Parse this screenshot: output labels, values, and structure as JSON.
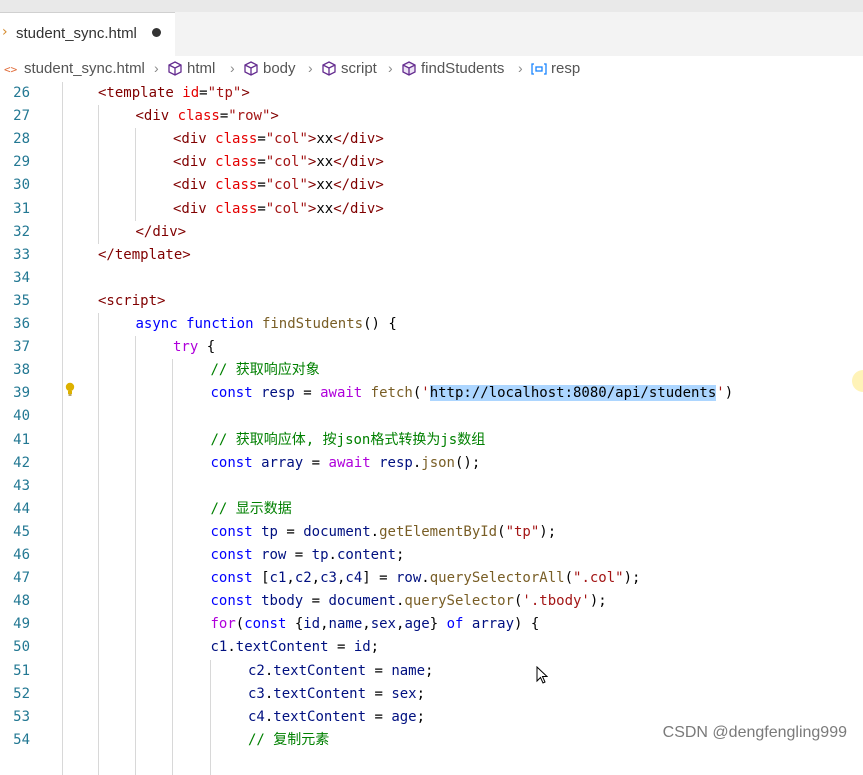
{
  "tab": {
    "filename": "student_sync.html"
  },
  "breadcrumb": {
    "items": [
      "student_sync.html",
      "html",
      "body",
      "script",
      "findStudents",
      "resp"
    ]
  },
  "editor": {
    "lines": [
      {
        "n": "26",
        "tokens": [
          [
            "tag",
            "<template "
          ],
          [
            "attr",
            "id"
          ],
          [
            "plain",
            "="
          ],
          [
            "str",
            "\"tp\""
          ],
          [
            "tag",
            ">"
          ]
        ]
      },
      {
        "n": "27",
        "tokens": [
          [
            "tag",
            "<div "
          ],
          [
            "attr",
            "class"
          ],
          [
            "plain",
            "="
          ],
          [
            "str",
            "\"row\""
          ],
          [
            "tag",
            ">"
          ]
        ]
      },
      {
        "n": "28",
        "tokens": [
          [
            "tag",
            "<div "
          ],
          [
            "attr",
            "class"
          ],
          [
            "plain",
            "="
          ],
          [
            "str",
            "\"col\""
          ],
          [
            "tag",
            ">"
          ],
          [
            "plain",
            "xx"
          ],
          [
            "tag",
            "</div>"
          ]
        ]
      },
      {
        "n": "29",
        "tokens": [
          [
            "tag",
            "<div "
          ],
          [
            "attr",
            "class"
          ],
          [
            "plain",
            "="
          ],
          [
            "str",
            "\"col\""
          ],
          [
            "tag",
            ">"
          ],
          [
            "plain",
            "xx"
          ],
          [
            "tag",
            "</div>"
          ]
        ]
      },
      {
        "n": "30",
        "tokens": [
          [
            "tag",
            "<div "
          ],
          [
            "attr",
            "class"
          ],
          [
            "plain",
            "="
          ],
          [
            "str",
            "\"col\""
          ],
          [
            "tag",
            ">"
          ],
          [
            "plain",
            "xx"
          ],
          [
            "tag",
            "</div>"
          ]
        ]
      },
      {
        "n": "31",
        "tokens": [
          [
            "tag",
            "<div "
          ],
          [
            "attr",
            "class"
          ],
          [
            "plain",
            "="
          ],
          [
            "str",
            "\"col\""
          ],
          [
            "tag",
            ">"
          ],
          [
            "plain",
            "xx"
          ],
          [
            "tag",
            "</div>"
          ]
        ]
      },
      {
        "n": "32",
        "tokens": [
          [
            "tag",
            "</div>"
          ]
        ]
      },
      {
        "n": "33",
        "tokens": [
          [
            "tag",
            "</template>"
          ]
        ]
      },
      {
        "n": "34",
        "tokens": []
      },
      {
        "n": "35",
        "tokens": [
          [
            "tag",
            "<script>"
          ]
        ]
      },
      {
        "n": "36",
        "tokens": [
          [
            "kw",
            "async function "
          ],
          [
            "fn",
            "findStudents"
          ],
          [
            "plain",
            "() {"
          ]
        ]
      },
      {
        "n": "37",
        "tokens": [
          [
            "ctl",
            "try"
          ],
          [
            "plain",
            " {"
          ]
        ]
      },
      {
        "n": "38",
        "tokens": [
          [
            "cm",
            "// 获取响应对象"
          ]
        ]
      },
      {
        "n": "39",
        "tokens": [
          [
            "kw",
            "const "
          ],
          [
            "var",
            "resp"
          ],
          [
            "plain",
            " = "
          ],
          [
            "ctl",
            "await "
          ],
          [
            "fn",
            "fetch"
          ],
          [
            "plain",
            "("
          ],
          [
            "str",
            "'"
          ],
          [
            "sel",
            "http://localhost:8080/api/students"
          ],
          [
            "str",
            "'"
          ],
          [
            "plain",
            ")"
          ]
        ]
      },
      {
        "n": "40",
        "tokens": []
      },
      {
        "n": "41",
        "tokens": [
          [
            "cm",
            "// 获取响应体, 按json格式转换为js数组"
          ]
        ]
      },
      {
        "n": "42",
        "tokens": [
          [
            "kw",
            "const "
          ],
          [
            "var",
            "array"
          ],
          [
            "plain",
            " = "
          ],
          [
            "ctl",
            "await "
          ],
          [
            "var",
            "resp"
          ],
          [
            "plain",
            "."
          ],
          [
            "fn",
            "json"
          ],
          [
            "plain",
            "();"
          ]
        ]
      },
      {
        "n": "43",
        "tokens": []
      },
      {
        "n": "44",
        "tokens": [
          [
            "cm",
            "// 显示数据"
          ]
        ]
      },
      {
        "n": "45",
        "tokens": [
          [
            "kw",
            "const "
          ],
          [
            "var",
            "tp"
          ],
          [
            "plain",
            " = "
          ],
          [
            "var",
            "document"
          ],
          [
            "plain",
            "."
          ],
          [
            "fn",
            "getElementById"
          ],
          [
            "plain",
            "("
          ],
          [
            "str",
            "\"tp\""
          ],
          [
            "plain",
            ");"
          ]
        ]
      },
      {
        "n": "46",
        "tokens": [
          [
            "kw",
            "const "
          ],
          [
            "var",
            "row"
          ],
          [
            "plain",
            " = "
          ],
          [
            "var",
            "tp"
          ],
          [
            "plain",
            "."
          ],
          [
            "var",
            "content"
          ],
          [
            "plain",
            ";"
          ]
        ]
      },
      {
        "n": "47",
        "tokens": [
          [
            "kw",
            "const "
          ],
          [
            "plain",
            "["
          ],
          [
            "var",
            "c1"
          ],
          [
            "plain",
            ","
          ],
          [
            "var",
            "c2"
          ],
          [
            "plain",
            ","
          ],
          [
            "var",
            "c3"
          ],
          [
            "plain",
            ","
          ],
          [
            "var",
            "c4"
          ],
          [
            "plain",
            "] = "
          ],
          [
            "var",
            "row"
          ],
          [
            "plain",
            "."
          ],
          [
            "fn",
            "querySelectorAll"
          ],
          [
            "plain",
            "("
          ],
          [
            "str",
            "\".col\""
          ],
          [
            "plain",
            ");"
          ]
        ]
      },
      {
        "n": "48",
        "tokens": [
          [
            "kw",
            "const "
          ],
          [
            "var",
            "tbody"
          ],
          [
            "plain",
            " = "
          ],
          [
            "var",
            "document"
          ],
          [
            "plain",
            "."
          ],
          [
            "fn",
            "querySelector"
          ],
          [
            "plain",
            "("
          ],
          [
            "str",
            "'.tbody'"
          ],
          [
            "plain",
            ");"
          ]
        ]
      },
      {
        "n": "49",
        "tokens": [
          [
            "ctl",
            "for"
          ],
          [
            "plain",
            "("
          ],
          [
            "kw",
            "const "
          ],
          [
            "plain",
            "{"
          ],
          [
            "var",
            "id"
          ],
          [
            "plain",
            ","
          ],
          [
            "var",
            "name"
          ],
          [
            "plain",
            ","
          ],
          [
            "var",
            "sex"
          ],
          [
            "plain",
            ","
          ],
          [
            "var",
            "age"
          ],
          [
            "plain",
            "} "
          ],
          [
            "kw",
            "of "
          ],
          [
            "var",
            "array"
          ],
          [
            "plain",
            ") {"
          ]
        ]
      },
      {
        "n": "50",
        "tokens": [
          [
            "var",
            "c1"
          ],
          [
            "plain",
            "."
          ],
          [
            "var",
            "textContent"
          ],
          [
            "plain",
            " = "
          ],
          [
            "var",
            "id"
          ],
          [
            "plain",
            ";"
          ]
        ]
      },
      {
        "n": "51",
        "tokens": [
          [
            "var",
            "c2"
          ],
          [
            "plain",
            "."
          ],
          [
            "var",
            "textContent"
          ],
          [
            "plain",
            " = "
          ],
          [
            "var",
            "name"
          ],
          [
            "plain",
            ";"
          ]
        ]
      },
      {
        "n": "52",
        "tokens": [
          [
            "var",
            "c3"
          ],
          [
            "plain",
            "."
          ],
          [
            "var",
            "textContent"
          ],
          [
            "plain",
            " = "
          ],
          [
            "var",
            "sex"
          ],
          [
            "plain",
            ";"
          ]
        ]
      },
      {
        "n": "53",
        "tokens": [
          [
            "var",
            "c4"
          ],
          [
            "plain",
            "."
          ],
          [
            "var",
            "textContent"
          ],
          [
            "plain",
            " = "
          ],
          [
            "var",
            "age"
          ],
          [
            "plain",
            ";"
          ]
        ]
      },
      {
        "n": "54",
        "tokens": [
          [
            "cm",
            "// 复制元素"
          ]
        ]
      }
    ]
  },
  "watermark": "CSDN @dengfengling999"
}
